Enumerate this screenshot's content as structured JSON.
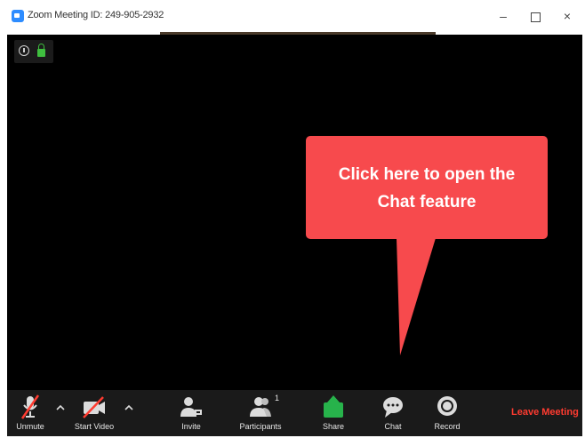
{
  "window": {
    "title": "Zoom Meeting ID: 249-905-2932",
    "controls": {
      "minimize": "–",
      "close": "×"
    }
  },
  "callout": {
    "line1": "Click here to open the",
    "line2": "Chat feature"
  },
  "toolbar": {
    "unmute": "Unmute",
    "start_video": "Start Video",
    "invite": "Invite",
    "participants": "Participants",
    "participants_count": "1",
    "share": "Share",
    "chat": "Chat",
    "record": "Record",
    "leave": "Leave Meeting"
  },
  "colors": {
    "callout": "#f74a4d",
    "toolbar": "#1a1a1a",
    "share_green": "#27b34b",
    "leave_red": "#ff3b30",
    "zoom_blue": "#2D8CFF"
  },
  "icons": {
    "app": "zoom-app-icon",
    "info": "info-icon",
    "lock": "lock-icon",
    "mic_muted": "mic-muted-icon",
    "video_off": "video-off-icon",
    "invite": "invite-icon",
    "participants": "participants-icon",
    "share": "share-screen-icon",
    "chat": "chat-bubble-icon",
    "record": "record-icon"
  }
}
